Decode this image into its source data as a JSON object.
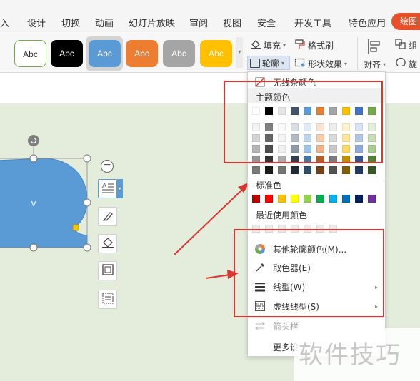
{
  "tabs": [
    "入",
    "设计",
    "切换",
    "动画",
    "幻灯片放映",
    "审阅",
    "视图",
    "安全",
    "开发工具",
    "特色应用",
    "绘图"
  ],
  "ribbon": {
    "style_label": "Abc",
    "fill": "填充",
    "format_brush": "格式刷",
    "outline": "轮廓",
    "shape_effect": "形状效果",
    "align": "对齐",
    "group": "组",
    "rotate": "旋"
  },
  "shape": {
    "text": "v"
  },
  "menu": {
    "no_line_color": "无线条颜色",
    "theme_colors": "主题颜色",
    "standard_colors": "标准色",
    "recent_colors": "最近使用颜色",
    "more_colors": "其他轮廓颜色(M)...",
    "eyedropper": "取色器(E)",
    "line_style": "线型(W)",
    "dash_style": "虚线线型(S)",
    "arrow_style": "箭头样",
    "more_settings": "更多设"
  },
  "watermark": "软件技巧",
  "colors": {
    "accent": "#e8502a",
    "highlight_box": "#e0352f",
    "shape_fill": "#5b9bd5",
    "slide_bg": "#e4eddc",
    "theme_row": [
      "#ffffff",
      "#000000",
      "#e7e6e6",
      "#44546a",
      "#5b9bd5",
      "#ed7d31",
      "#a5a5a5",
      "#ffc000",
      "#4472c4",
      "#70ad47"
    ],
    "standard_row": [
      "#c00000",
      "#ff0000",
      "#ffc000",
      "#ffff00",
      "#92d050",
      "#00b050",
      "#00b0f0",
      "#0070c0",
      "#002060",
      "#7030a0"
    ]
  }
}
